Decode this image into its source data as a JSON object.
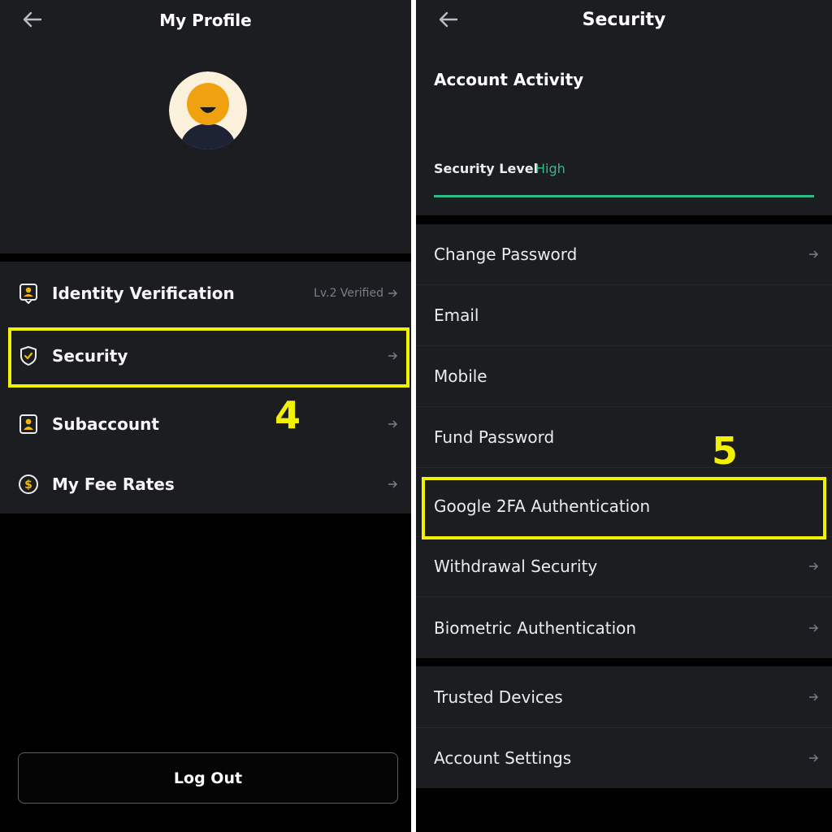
{
  "left": {
    "title": "My Profile",
    "menu": [
      {
        "label": "Identity Verification",
        "meta": "Lv.2 Verified",
        "icon": "id-badge-icon"
      },
      {
        "label": "Security",
        "icon": "shield-check-icon"
      },
      {
        "label": "Subaccount",
        "icon": "user-square-icon"
      },
      {
        "label": "My Fee Rates",
        "icon": "dollar-coin-icon"
      }
    ],
    "logout_label": "Log Out",
    "step_label": "4"
  },
  "right": {
    "title": "Security",
    "account_activity": "Account Activity",
    "security_level_label": "Security Level",
    "security_level_value": "High",
    "items": [
      {
        "label": "Change Password"
      },
      {
        "label": "Email"
      },
      {
        "label": "Mobile"
      },
      {
        "label": "Fund Password"
      },
      {
        "label": "Google 2FA Authentication"
      },
      {
        "label": "Withdrawal Security"
      },
      {
        "label": "Biometric Authentication"
      },
      {
        "label": "Trusted Devices"
      },
      {
        "label": "Account Settings"
      }
    ],
    "step_label": "5"
  },
  "colors": {
    "accent": "#f0b90b",
    "highlight": "#f2f200",
    "success": "#2ebd85",
    "surface": "#1c1d21",
    "background": "#000000"
  }
}
